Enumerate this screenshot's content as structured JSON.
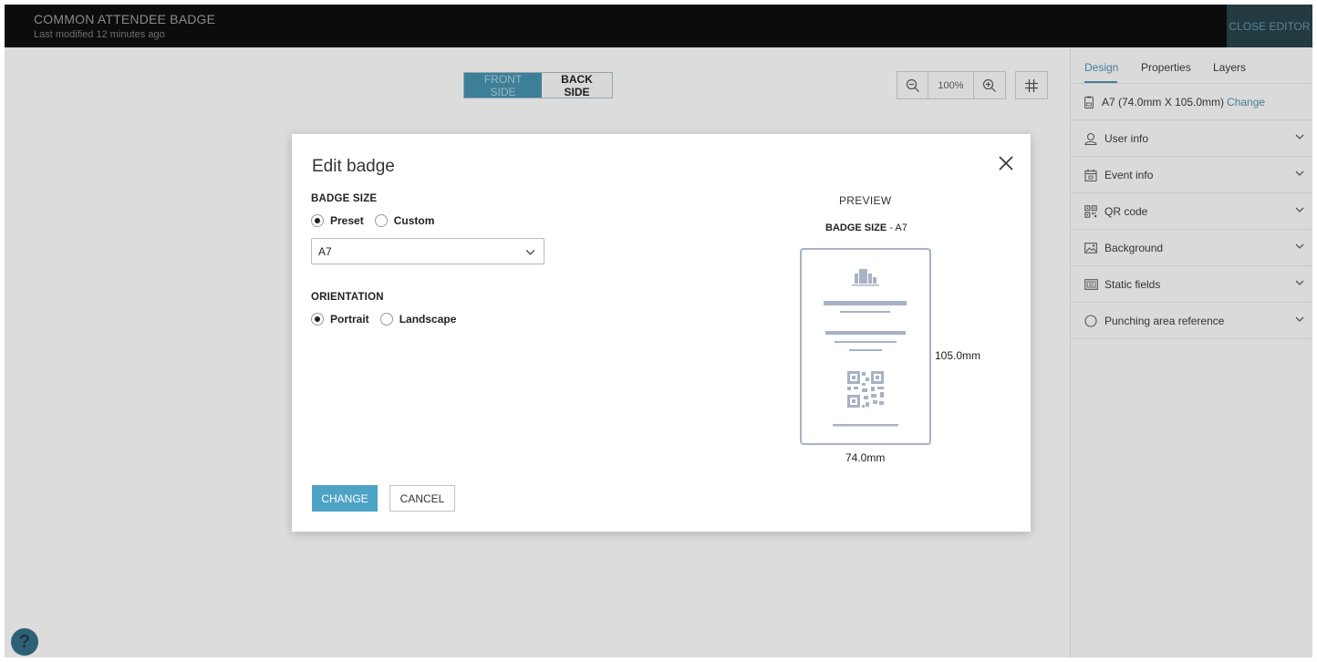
{
  "topbar": {
    "title": "COMMON ATTENDEE BADGE",
    "subtitle": "Last modified 12 minutes ago",
    "close_label": "CLOSE EDITOR"
  },
  "canvas": {
    "front_label": "FRONT SIDE",
    "back_label": "BACK SIDE",
    "zoom_value": "100%",
    "help_label": "?"
  },
  "panel": {
    "tabs": [
      "Design",
      "Properties",
      "Layers"
    ],
    "active_tab": "Design",
    "size_text": "A7 (74.0mm X 105.0mm)",
    "size_link": "Change",
    "items": [
      {
        "label": "User info",
        "icon": "user-icon"
      },
      {
        "label": "Event info",
        "icon": "calendar-icon"
      },
      {
        "label": "QR code",
        "icon": "qr-icon"
      },
      {
        "label": "Background",
        "icon": "image-icon"
      },
      {
        "label": "Static fields",
        "icon": "fields-icon"
      },
      {
        "label": "Punching area reference",
        "icon": "circle-icon"
      }
    ]
  },
  "modal": {
    "title": "Edit badge",
    "badge_size_label": "BADGE SIZE",
    "preset_label": "Preset",
    "custom_label": "Custom",
    "selected_size": "A7",
    "orientation_label": "ORIENTATION",
    "portrait_label": "Portrait",
    "landscape_label": "Landscape",
    "preview_title": "PREVIEW",
    "preview_size_prefix": "BADGE SIZE",
    "preview_size_value": " - A7",
    "height_label": "105.0mm",
    "width_label": "74.0mm",
    "change_label": "CHANGE",
    "cancel_label": "CANCEL"
  },
  "colors": {
    "accent": "#4ca3c6",
    "topbar": "#0c0c0c",
    "preview_stroke": "#a7b2c4"
  }
}
